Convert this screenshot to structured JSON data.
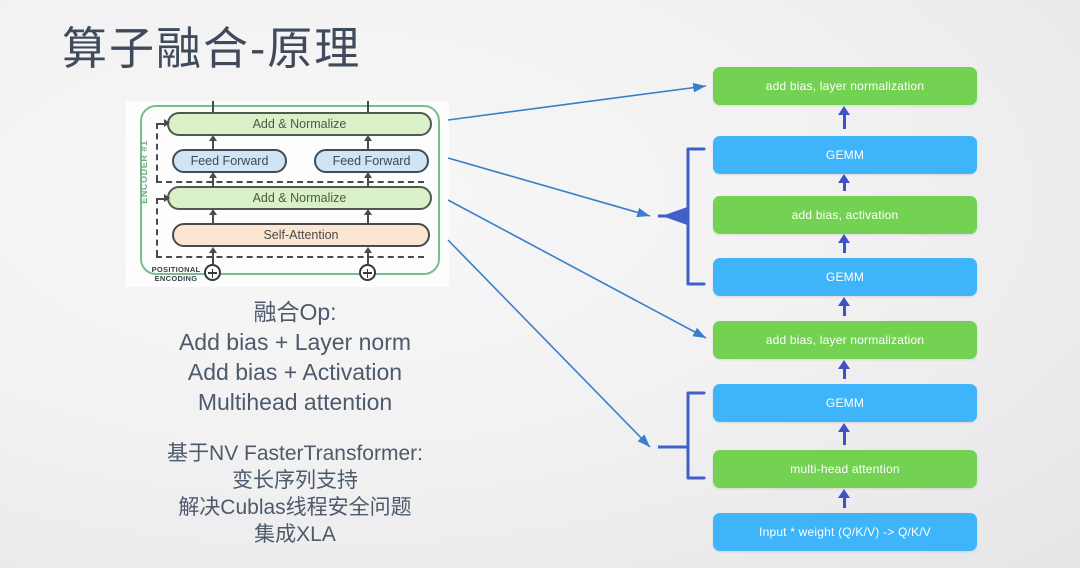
{
  "slide": {
    "title": "算子融合-原理",
    "background_color": "#f2f2f3"
  },
  "encoder_diagram": {
    "label": "ENCODER #1",
    "boxes": {
      "add_normalize_top": "Add & Normalize",
      "feed_forward_left": "Feed Forward",
      "feed_forward_right": "Feed Forward",
      "add_normalize_mid": "Add & Normalize",
      "self_attention": "Self-Attention"
    },
    "positional_encoding_label": "POSITIONAL\nENCODING",
    "colors": {
      "outline": "#78bd8d",
      "add_normalize": "#d9f0c8",
      "feed_forward": "#cfe4f5",
      "self_attention": "#fbe6d2"
    }
  },
  "fusion_text": {
    "heading": "融合Op:",
    "lines": [
      "Add bias + Layer norm",
      "Add bias + Activation",
      "Multihead attention"
    ],
    "full": "融合Op:\nAdd bias + Layer norm\nAdd bias + Activation\nMultihead attention"
  },
  "faster_transformer_text": {
    "heading": "基于NV FasterTransformer:",
    "lines": [
      "变长序列支持",
      "解决Cublas线程安全问题",
      "集成XLA"
    ],
    "full": "基于NV FasterTransformer:\n变长序列支持\n解决Cublas线程安全问题\n集成XLA"
  },
  "flow": {
    "colors": {
      "green": "#74d252",
      "blue": "#3eb4fb",
      "arrow": "#3f51c5",
      "connector": "#3a7ec9"
    },
    "blocks": [
      {
        "label": "add bias, layer normalization",
        "kind": "green"
      },
      {
        "label": "GEMM",
        "kind": "blue"
      },
      {
        "label": "add bias, activation",
        "kind": "green"
      },
      {
        "label": "GEMM",
        "kind": "blue"
      },
      {
        "label": "add bias, layer normalization",
        "kind": "green"
      },
      {
        "label": "GEMM",
        "kind": "blue"
      },
      {
        "label": "multi-head attention",
        "kind": "green"
      },
      {
        "label": "Input * weight (Q/K/V) -> Q/K/V",
        "kind": "blue"
      }
    ]
  }
}
